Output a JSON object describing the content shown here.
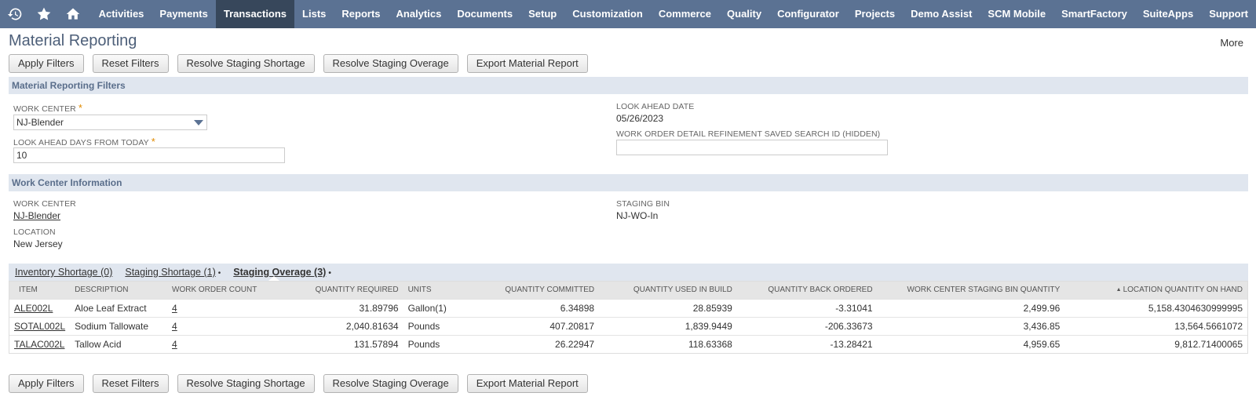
{
  "nav": {
    "items": [
      {
        "label": "Activities",
        "active": false
      },
      {
        "label": "Payments",
        "active": false
      },
      {
        "label": "Transactions",
        "active": true
      },
      {
        "label": "Lists",
        "active": false
      },
      {
        "label": "Reports",
        "active": false
      },
      {
        "label": "Analytics",
        "active": false
      },
      {
        "label": "Documents",
        "active": false
      },
      {
        "label": "Setup",
        "active": false
      },
      {
        "label": "Customization",
        "active": false
      },
      {
        "label": "Commerce",
        "active": false
      },
      {
        "label": "Quality",
        "active": false
      },
      {
        "label": "Configurator",
        "active": false
      },
      {
        "label": "Projects",
        "active": false
      },
      {
        "label": "Demo Assist",
        "active": false
      },
      {
        "label": "SCM Mobile",
        "active": false
      },
      {
        "label": "SmartFactory",
        "active": false
      },
      {
        "label": "SuiteApps",
        "active": false
      },
      {
        "label": "Support",
        "active": false
      }
    ],
    "icons": [
      "history-icon",
      "star-icon",
      "home-icon"
    ],
    "bar_color": "#5b7293",
    "active_color": "#37475b"
  },
  "page": {
    "title": "Material Reporting",
    "more": "More"
  },
  "buttons": {
    "apply": "Apply Filters",
    "reset": "Reset Filters",
    "resolve_shortage": "Resolve Staging Shortage",
    "resolve_overage": "Resolve Staging Overage",
    "export": "Export Material Report"
  },
  "filters": {
    "section_title": "Material Reporting Filters",
    "work_center_label": "Work Center",
    "work_center_value": "NJ-Blender",
    "look_ahead_days_label": "Look Ahead Days From Today",
    "look_ahead_days_value": "10",
    "look_ahead_date_label": "Look Ahead Date",
    "look_ahead_date_value": "05/26/2023",
    "saved_search_label": "Work Order Detail Refinement Saved Search ID (Hidden)",
    "saved_search_value": "",
    "required_mark": "*"
  },
  "work_center_info": {
    "section_title": "Work Center Information",
    "work_center_label": "Work Center",
    "work_center_value": "NJ-Blender",
    "location_label": "Location",
    "location_value": "New Jersey",
    "staging_bin_label": "Staging Bin",
    "staging_bin_value": "NJ-WO-In"
  },
  "subtabs": [
    {
      "label": "Inventory Shortage (0)",
      "dot": "",
      "active": false
    },
    {
      "label": "Staging Shortage (1)",
      "dot": "•",
      "active": false
    },
    {
      "label": "Staging Overage (3)",
      "dot": "•",
      "active": true
    }
  ],
  "table": {
    "columns": [
      "Item",
      "Description",
      "Work Order Count",
      "Quantity Required",
      "Units",
      "Quantity Committed",
      "Quantity Used in Build",
      "Quantity Back Ordered",
      "Work Center Staging Bin Quantity",
      "Location Quantity on Hand"
    ],
    "sort_indicator": "▲",
    "rows": [
      {
        "item": "ALE002L",
        "description": "Aloe Leaf Extract",
        "wo_count": "4",
        "qty_required": "31.89796",
        "units": "Gallon(1)",
        "qty_committed": "6.34898",
        "qty_used": "28.85939",
        "qty_back": "-3.31041",
        "staging_qty": "2,499.96",
        "on_hand": "5,158.4304630999995"
      },
      {
        "item": "SOTAL002L",
        "description": "Sodium Tallowate",
        "wo_count": "4",
        "qty_required": "2,040.81634",
        "units": "Pounds",
        "qty_committed": "407.20817",
        "qty_used": "1,839.9449",
        "qty_back": "-206.33673",
        "staging_qty": "3,436.85",
        "on_hand": "13,564.5661072"
      },
      {
        "item": "TALAC002L",
        "description": "Tallow Acid",
        "wo_count": "4",
        "qty_required": "131.57894",
        "units": "Pounds",
        "qty_committed": "26.22947",
        "qty_used": "118.63368",
        "qty_back": "-13.28421",
        "staging_qty": "4,959.65",
        "on_hand": "9,812.71400065"
      }
    ]
  }
}
